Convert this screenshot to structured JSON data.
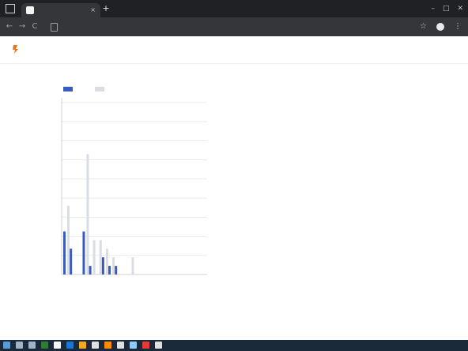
{
  "browser": {
    "tab_title": "",
    "url": "",
    "new_tab": "+",
    "tab_close": "×"
  },
  "window_controls": {
    "minimize": "–",
    "maximize": "□",
    "close": "✕"
  },
  "nav": {
    "back": "←",
    "forward": "→",
    "reload": "C"
  },
  "toolbar_right": {
    "star": "☆",
    "menu": "⋮"
  },
  "app": {
    "brand": "",
    "header_center": "",
    "header_right": ""
  },
  "chart_data": {
    "type": "bar",
    "title": "",
    "legend_position": "top-left",
    "grid": true,
    "ylim": [
      0,
      5
    ],
    "yticks": [],
    "categories": [
      "",
      "",
      "",
      "",
      "",
      "",
      "",
      "",
      "",
      "",
      "",
      "",
      "",
      ""
    ],
    "series": [
      {
        "name": "",
        "color": "#3a5bbf",
        "values": [
          1.25,
          0.75,
          0,
          1.25,
          0.25,
          0,
          0.5,
          0.25,
          0.25,
          0,
          0,
          0,
          0,
          0
        ]
      },
      {
        "name": "",
        "color": "#d9dde6",
        "values": [
          2.0,
          0,
          0,
          3.5,
          1.0,
          1.0,
          0.75,
          0.5,
          0,
          0,
          0.5,
          0,
          0,
          0
        ]
      }
    ]
  },
  "taskbar": {
    "icons": [
      {
        "name": "start-icon",
        "color": "#5b9bd5"
      },
      {
        "name": "search-icon",
        "color": "#9fb3c8"
      },
      {
        "name": "task-view-icon",
        "color": "#9fb3c8"
      },
      {
        "name": "app-icon-1",
        "color": "#2e7d32"
      },
      {
        "name": "app-icon-2",
        "color": "#f5f5f5"
      },
      {
        "name": "app-icon-3",
        "color": "#1976d2"
      },
      {
        "name": "app-icon-4",
        "color": "#f9a825"
      },
      {
        "name": "app-icon-5",
        "color": "#e0e0e0"
      },
      {
        "name": "app-icon-6",
        "color": "#fb8c00"
      },
      {
        "name": "app-icon-7",
        "color": "#e0e0e0"
      },
      {
        "name": "app-icon-8",
        "color": "#90caf9"
      },
      {
        "name": "app-icon-9",
        "color": "#e53935"
      },
      {
        "name": "app-icon-10",
        "color": "#e0e0e0"
      }
    ],
    "tray_text": ""
  },
  "colors": {
    "chrome_dark": "#202124",
    "toolbar": "#35363a",
    "taskbar": "#1b2a3a",
    "accent": "#3a5bbf",
    "logo": "#e8741e"
  }
}
